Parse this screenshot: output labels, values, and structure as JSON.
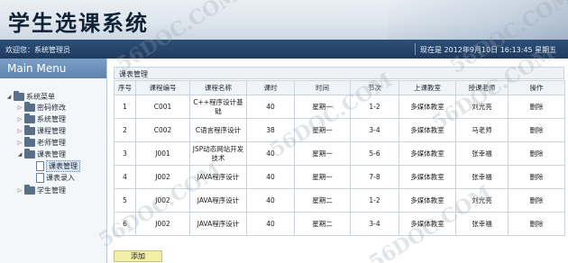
{
  "header": {
    "title": "学生选课系统"
  },
  "infobar": {
    "welcome": "欢迎您：系统管理员",
    "now": "现在是 2012年9月10日 16:13:45 星期五"
  },
  "sidebar": {
    "menu_title": "Main Menu",
    "root": "系统菜单",
    "items": [
      {
        "label": "密码修改"
      },
      {
        "label": "系统管理"
      },
      {
        "label": "课程管理"
      },
      {
        "label": "老师管理"
      },
      {
        "label": "课表管理",
        "children": [
          {
            "label": "课表管理"
          },
          {
            "label": "课表录入"
          }
        ]
      },
      {
        "label": "学生管理"
      }
    ]
  },
  "main": {
    "panel_title": "课表管理",
    "columns": [
      "序号",
      "课程编号",
      "课程名称",
      "课时",
      "时间",
      "节次",
      "上课教室",
      "授课老师",
      "操作"
    ],
    "rows": [
      [
        "1",
        "C001",
        "C++程序设计基础",
        "40",
        "星期一",
        "1-2",
        "多媒体教室",
        "刘光亮",
        "删除"
      ],
      [
        "2",
        "C002",
        "C语言程序设计",
        "38",
        "星期一",
        "3-4",
        "多媒体教室",
        "马老师",
        "删除"
      ],
      [
        "3",
        "J001",
        "JSP动态网站开发技术",
        "40",
        "星期一",
        "5-6",
        "多媒体教室",
        "张幸福",
        "删除"
      ],
      [
        "4",
        "J002",
        "JAVA程序设计",
        "40",
        "星期一",
        "7-8",
        "多媒体教室",
        "张幸福",
        "删除"
      ],
      [
        "5",
        "J002",
        "JAVA程序设计",
        "40",
        "星期二",
        "1-2",
        "多媒体教室",
        "刘光亮",
        "删除"
      ],
      [
        "6",
        "J002",
        "JAVA程序设计",
        "40",
        "星期二",
        "3-4",
        "多媒体教室",
        "张幸福",
        "删除"
      ]
    ],
    "add_label": "添加"
  },
  "watermark": "56DOC.COM"
}
